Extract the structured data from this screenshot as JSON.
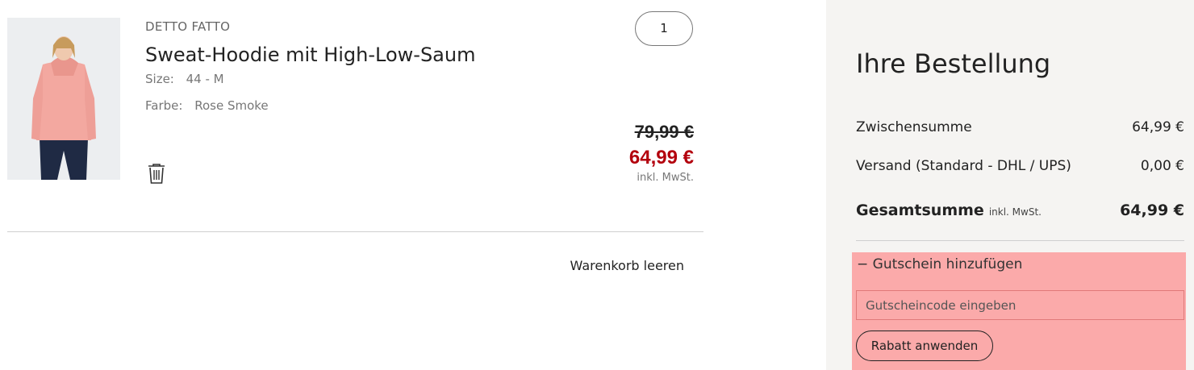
{
  "cart": {
    "item": {
      "brand": "DETTO FATTO",
      "name": "Sweat-Hoodie mit High-Low-Saum",
      "size_label": "Size:",
      "size_value": "44 - M",
      "color_label": "Farbe:",
      "color_value": "Rose Smoke",
      "quantity": "1",
      "price_old": "79,99 €",
      "price_new": "64,99 €",
      "price_tax_note": "inkl. MwSt.",
      "image_icon": "product-photo-icon",
      "delete_icon": "trash-icon"
    },
    "clear_label": "Warenkorb leeren"
  },
  "summary": {
    "title": "Ihre Bestellung",
    "subtotal_label": "Zwischensumme",
    "subtotal_value": "64,99 €",
    "shipping_label": "Versand (Standard - DHL / UPS)",
    "shipping_value": "0,00 €",
    "total_label": "Gesamtsumme",
    "total_tax_note": "inkl. MwSt.",
    "total_value": "64,99 €"
  },
  "coupon": {
    "toggle_label": "− Gutschein hinzufügen",
    "input_placeholder": "Gutscheincode eingeben",
    "apply_label": "Rabatt anwenden"
  },
  "colors": {
    "sale_price": "#b3000d",
    "summary_bg": "#f5f4f2",
    "coupon_highlight": "#fbaaaa"
  }
}
